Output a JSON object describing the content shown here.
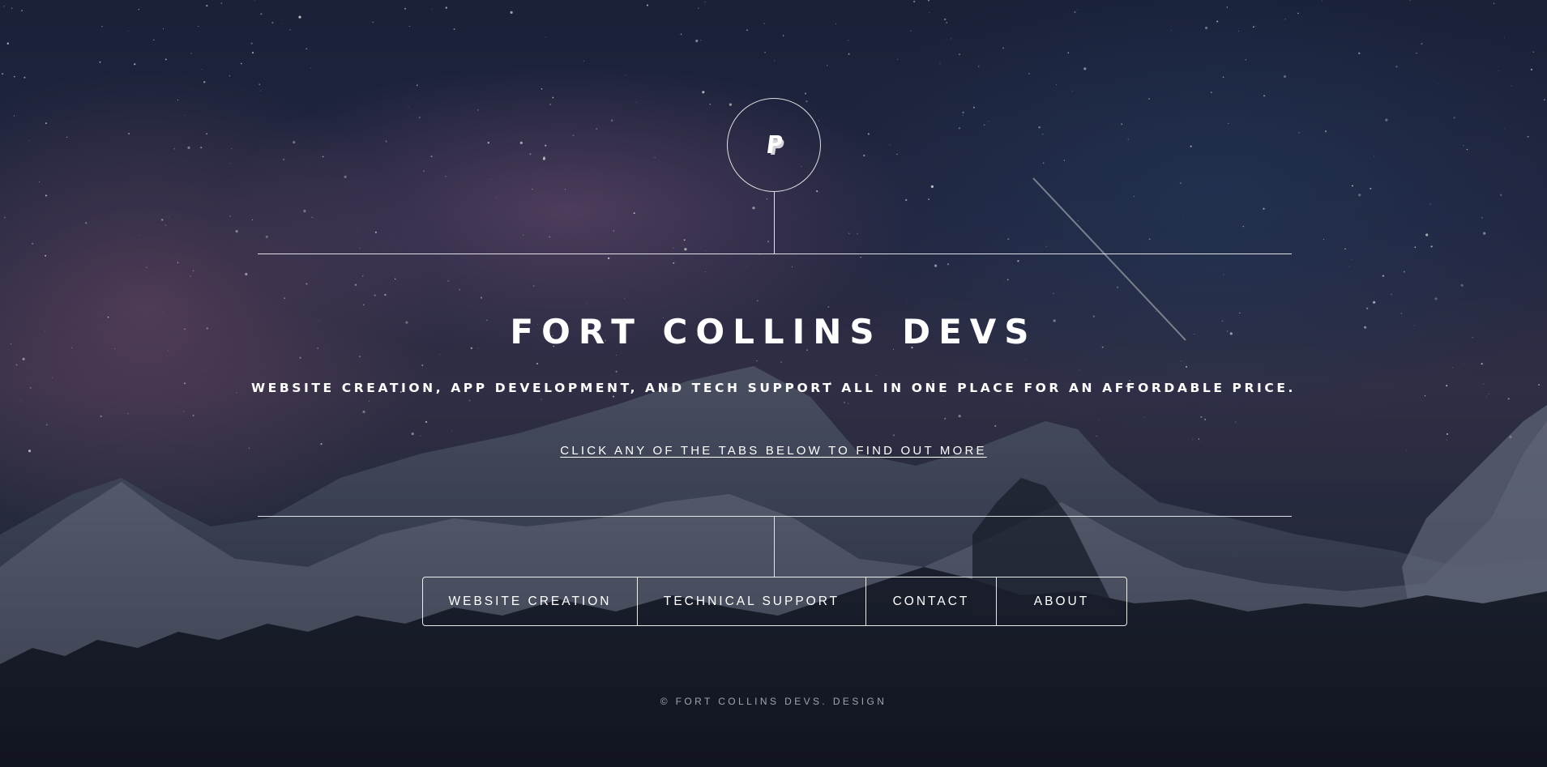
{
  "header": {
    "logo_icon": "paypal-p-icon"
  },
  "main": {
    "title": "FORT COLLINS DEVS",
    "subtitle": "WEBSITE CREATION, APP DEVELOPMENT, AND TECH SUPPORT ALL IN ONE PLACE FOR AN AFFORDABLE PRICE.",
    "cta_link": "CLICK ANY OF THE TABS BELOW TO FIND OUT MORE"
  },
  "nav": {
    "items": [
      {
        "label": "WEBSITE CREATION"
      },
      {
        "label": "TECHNICAL SUPPORT"
      },
      {
        "label": "CONTACT"
      },
      {
        "label": "ABOUT"
      }
    ]
  },
  "footer": {
    "text": "© FORT COLLINS DEVS. DESIGN"
  },
  "colors": {
    "text": "#ffffff",
    "line": "#ffffff",
    "sky_top": "#1c2440",
    "milky_way": "#aa6ea0",
    "mountains": "#3a4154",
    "forest": "#14171f"
  }
}
